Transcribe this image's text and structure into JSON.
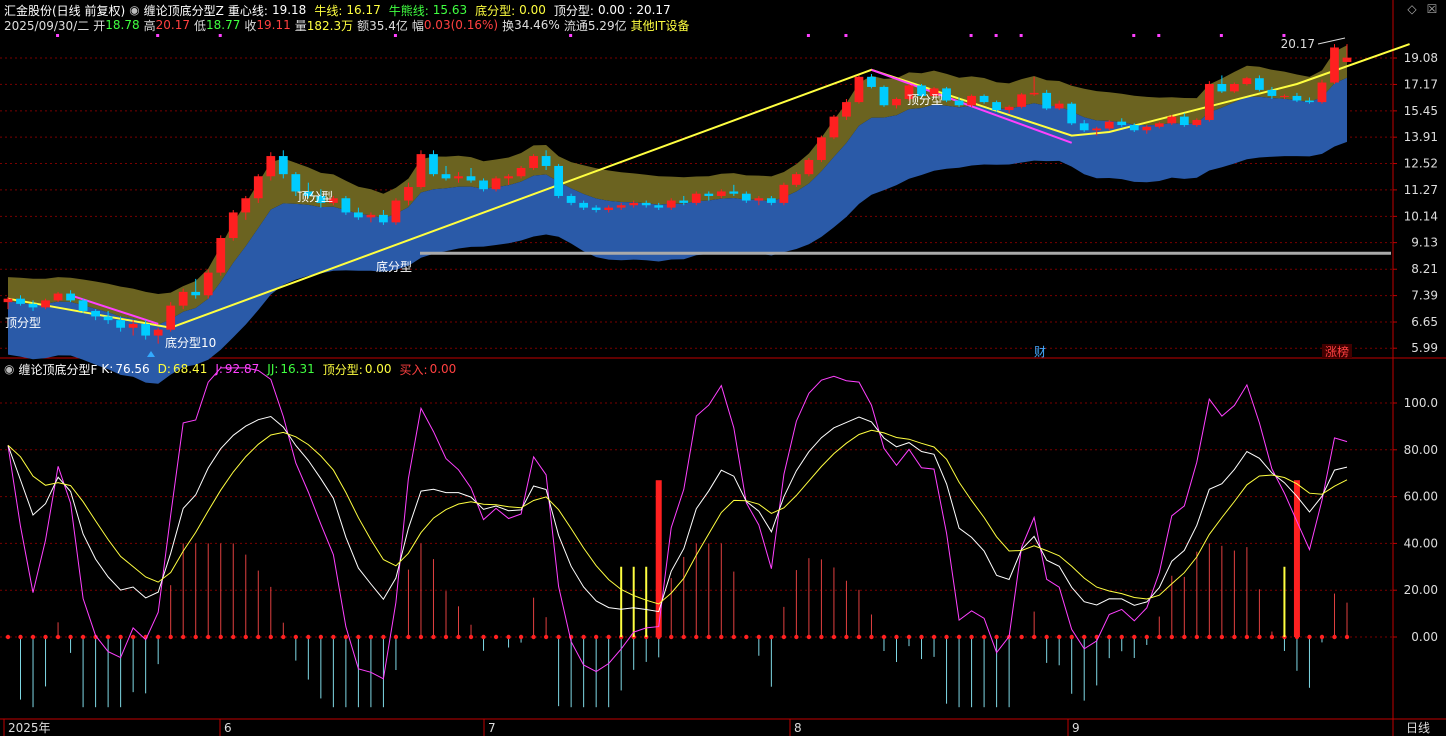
{
  "header1": {
    "stock": "汇金股份(日线 前复权)",
    "indicator": "缠论顶底分型Z",
    "zx_label": "重心线:",
    "zx": "19.18",
    "nx_label": "牛线:",
    "nx": "16.17",
    "nxx_label": "牛熊线:",
    "nxx": "15.63",
    "dfx_label": "底分型:",
    "dfx": "0.00",
    "dingfx_label": "顶分型:",
    "dingfx": "0.00 : 20.17"
  },
  "header2": {
    "date": "2025/09/30/二",
    "open_label": "开",
    "open": "18.78",
    "high_label": "高",
    "high": "20.17",
    "low_label": "低",
    "low": "18.77",
    "close_label": "收",
    "close": "19.11",
    "vol_label": "量",
    "vol": "182.3万",
    "amt_label": "额",
    "amt": "35.4亿",
    "chg_label": "幅",
    "chg": "0.03(0.16%)",
    "turn_label": "换",
    "turn": "34.46%",
    "float_label": "流通",
    "float": "5.29亿",
    "sector": "其他IT设备"
  },
  "sub_header": {
    "name": "缠论顶底分型F",
    "k_label": "K:",
    "k": "76.56",
    "d_label": "D:",
    "d": "68.41",
    "j_label": "J:",
    "j": "92.87",
    "jj_label": "JJ:",
    "jj": "16.31",
    "dfx_label": "顶分型:",
    "dfx": "0.00",
    "buy_label": "买入:",
    "buy": "0.00"
  },
  "annotations": {
    "top1": "顶分型",
    "top2": "顶分型",
    "top3": "顶分型",
    "bottom1": "底分型",
    "bottom2": "底分型10",
    "high_mark": "20.17",
    "cai": "财",
    "zhangting": "涨榜"
  },
  "y_axis_main": [
    "19.08",
    "17.17",
    "15.45",
    "13.91",
    "12.52",
    "11.27",
    "10.14",
    "9.13",
    "8.21",
    "7.39",
    "6.65",
    "5.99"
  ],
  "y_axis_sub": [
    "100.0",
    "80.00",
    "60.00",
    "40.00",
    "20.00",
    "0.00"
  ],
  "x_axis": {
    "labels": [
      "2025年",
      "6",
      "7",
      "8",
      "9"
    ],
    "period": "日线"
  },
  "colors": {
    "up": "#ff2020",
    "down": "#00ccff",
    "bull": "#2a5aa8",
    "bear": "#6b6320",
    "line": "#ffff40",
    "grid": "#7a0000"
  },
  "chart_data": {
    "type": "candlestick",
    "candles": [
      [
        7.2,
        7.35,
        7.0,
        7.3
      ],
      [
        7.3,
        7.4,
        7.1,
        7.15
      ],
      [
        7.15,
        7.25,
        6.95,
        7.05
      ],
      [
        7.05,
        7.3,
        7.0,
        7.25
      ],
      [
        7.25,
        7.5,
        7.2,
        7.45
      ],
      [
        7.45,
        7.55,
        7.2,
        7.25
      ],
      [
        7.25,
        7.3,
        6.9,
        6.95
      ],
      [
        6.95,
        7.0,
        6.7,
        6.8
      ],
      [
        6.8,
        6.95,
        6.6,
        6.7
      ],
      [
        6.7,
        6.8,
        6.4,
        6.5
      ],
      [
        6.5,
        6.7,
        6.3,
        6.6
      ],
      [
        6.6,
        6.7,
        6.2,
        6.3
      ],
      [
        6.3,
        6.5,
        6.1,
        6.45
      ],
      [
        6.45,
        7.2,
        6.4,
        7.1
      ],
      [
        7.1,
        7.6,
        7.0,
        7.5
      ],
      [
        7.5,
        7.9,
        7.3,
        7.4
      ],
      [
        7.4,
        8.2,
        7.3,
        8.1
      ],
      [
        8.1,
        9.4,
        8.0,
        9.3
      ],
      [
        9.3,
        10.4,
        9.2,
        10.3
      ],
      [
        10.3,
        11.0,
        10.0,
        10.9
      ],
      [
        10.9,
        12.0,
        10.7,
        11.9
      ],
      [
        11.9,
        13.1,
        11.7,
        12.9
      ],
      [
        12.9,
        13.2,
        11.8,
        12.0
      ],
      [
        12.0,
        12.1,
        11.0,
        11.2
      ],
      [
        11.2,
        11.6,
        10.9,
        11.0
      ],
      [
        11.0,
        11.3,
        10.5,
        10.7
      ],
      [
        10.7,
        11.0,
        10.6,
        10.9
      ],
      [
        10.9,
        11.0,
        10.2,
        10.3
      ],
      [
        10.3,
        10.5,
        10.0,
        10.1
      ],
      [
        10.1,
        10.3,
        9.9,
        10.2
      ],
      [
        10.2,
        10.4,
        9.8,
        9.9
      ],
      [
        9.9,
        10.9,
        9.8,
        10.8
      ],
      [
        10.8,
        11.6,
        10.6,
        11.4
      ],
      [
        11.4,
        13.2,
        11.3,
        13.0
      ],
      [
        13.0,
        13.2,
        11.9,
        12.0
      ],
      [
        12.0,
        12.4,
        11.7,
        11.8
      ],
      [
        11.8,
        12.1,
        11.6,
        11.9
      ],
      [
        11.9,
        12.3,
        11.6,
        11.7
      ],
      [
        11.7,
        11.8,
        11.2,
        11.3
      ],
      [
        11.3,
        11.9,
        11.2,
        11.8
      ],
      [
        11.8,
        12.0,
        11.5,
        11.9
      ],
      [
        11.9,
        12.4,
        11.8,
        12.3
      ],
      [
        12.3,
        13.0,
        12.2,
        12.9
      ],
      [
        12.9,
        13.2,
        12.2,
        12.4
      ],
      [
        12.4,
        12.5,
        10.9,
        11.0
      ],
      [
        11.0,
        11.1,
        10.6,
        10.7
      ],
      [
        10.7,
        10.8,
        10.4,
        10.5
      ],
      [
        10.5,
        10.6,
        10.3,
        10.4
      ],
      [
        10.4,
        10.6,
        10.3,
        10.5
      ],
      [
        10.5,
        10.7,
        10.4,
        10.6
      ],
      [
        10.6,
        10.8,
        10.5,
        10.7
      ],
      [
        10.7,
        10.8,
        10.5,
        10.6
      ],
      [
        10.6,
        10.7,
        10.4,
        10.5
      ],
      [
        10.5,
        10.9,
        10.4,
        10.8
      ],
      [
        10.8,
        11.0,
        10.6,
        10.7
      ],
      [
        10.7,
        11.2,
        10.6,
        11.1
      ],
      [
        11.1,
        11.2,
        10.8,
        11.0
      ],
      [
        11.0,
        11.3,
        10.9,
        11.2
      ],
      [
        11.2,
        11.5,
        11.0,
        11.1
      ],
      [
        11.1,
        11.2,
        10.7,
        10.8
      ],
      [
        10.8,
        11.0,
        10.6,
        10.9
      ],
      [
        10.9,
        11.0,
        10.6,
        10.7
      ],
      [
        10.7,
        11.6,
        10.6,
        11.5
      ],
      [
        11.5,
        12.1,
        11.4,
        12.0
      ],
      [
        12.0,
        12.8,
        11.9,
        12.7
      ],
      [
        12.7,
        14.0,
        12.6,
        13.9
      ],
      [
        13.9,
        15.2,
        13.8,
        15.1
      ],
      [
        15.1,
        16.2,
        14.9,
        16.0
      ],
      [
        16.0,
        17.8,
        15.9,
        17.7
      ],
      [
        17.7,
        17.9,
        16.9,
        17.0
      ],
      [
        17.0,
        17.1,
        15.7,
        15.8
      ],
      [
        15.8,
        16.3,
        15.6,
        16.2
      ],
      [
        16.2,
        17.2,
        16.1,
        17.1
      ],
      [
        17.1,
        17.2,
        16.3,
        16.4
      ],
      [
        16.4,
        17.0,
        16.3,
        16.9
      ],
      [
        16.9,
        17.0,
        16.0,
        16.1
      ],
      [
        16.1,
        16.3,
        15.7,
        15.8
      ],
      [
        15.8,
        16.5,
        15.7,
        16.4
      ],
      [
        16.4,
        16.5,
        15.9,
        16.0
      ],
      [
        16.0,
        16.1,
        15.4,
        15.5
      ],
      [
        15.5,
        15.8,
        15.3,
        15.7
      ],
      [
        15.7,
        16.6,
        15.6,
        16.5
      ],
      [
        16.5,
        17.7,
        16.4,
        16.6
      ],
      [
        16.6,
        16.8,
        15.5,
        15.6
      ],
      [
        15.6,
        16.1,
        15.5,
        15.9
      ],
      [
        15.9,
        16.0,
        14.6,
        14.7
      ],
      [
        14.7,
        14.9,
        14.2,
        14.3
      ],
      [
        14.3,
        14.5,
        14.0,
        14.4
      ],
      [
        14.4,
        14.9,
        14.3,
        14.8
      ],
      [
        14.8,
        15.0,
        14.5,
        14.6
      ],
      [
        14.6,
        14.7,
        14.2,
        14.3
      ],
      [
        14.3,
        14.6,
        14.1,
        14.5
      ],
      [
        14.5,
        14.8,
        14.4,
        14.7
      ],
      [
        14.7,
        15.2,
        14.6,
        15.1
      ],
      [
        15.1,
        15.3,
        14.5,
        14.6
      ],
      [
        14.6,
        15.0,
        14.5,
        14.9
      ],
      [
        14.9,
        17.4,
        14.8,
        17.2
      ],
      [
        17.2,
        17.8,
        16.6,
        16.7
      ],
      [
        16.7,
        17.3,
        16.6,
        17.2
      ],
      [
        17.2,
        17.7,
        17.1,
        17.6
      ],
      [
        17.6,
        17.8,
        16.7,
        16.8
      ],
      [
        16.8,
        17.0,
        16.2,
        16.4
      ],
      [
        16.4,
        16.5,
        16.2,
        16.4
      ],
      [
        16.4,
        16.6,
        16.0,
        16.1
      ],
      [
        16.1,
        16.3,
        15.9,
        16.0
      ],
      [
        16.0,
        17.5,
        15.9,
        17.3
      ],
      [
        17.3,
        20.17,
        17.2,
        19.9
      ],
      [
        18.78,
        20.17,
        18.77,
        19.11
      ]
    ]
  }
}
